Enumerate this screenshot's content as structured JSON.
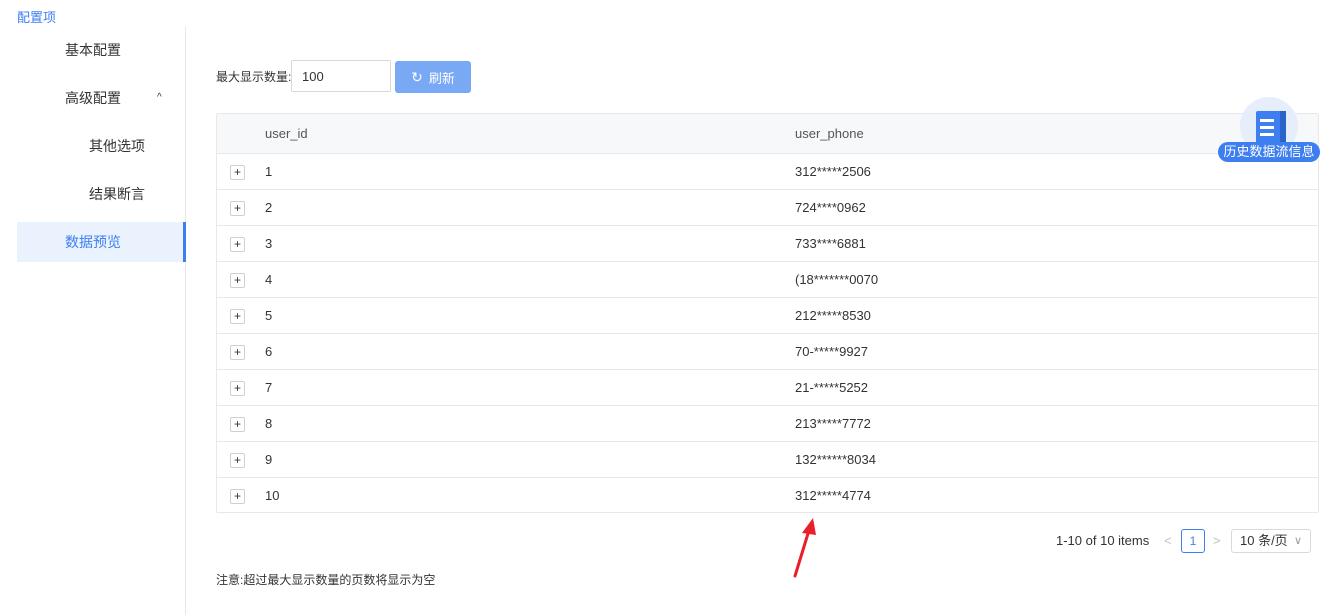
{
  "page_title": "配置项",
  "sidebar": {
    "items": [
      {
        "label": "基本配置"
      },
      {
        "label": "高级配置",
        "icon": "chevron-up-icon",
        "glyph": "^"
      },
      {
        "label": "其他选项"
      },
      {
        "label": "结果断言"
      },
      {
        "label": "数据预览"
      }
    ]
  },
  "toolbar": {
    "max_label": "最大显示数量:",
    "max_value": "100",
    "refresh_label": "刷新",
    "refresh_icon": "refresh-icon",
    "refresh_glyph": "↻"
  },
  "table": {
    "columns": [
      "user_id",
      "user_phone"
    ],
    "expand_glyph": "+",
    "rows": [
      {
        "user_id": "1",
        "user_phone": "312*****2506"
      },
      {
        "user_id": "2",
        "user_phone": "724****0962"
      },
      {
        "user_id": "3",
        "user_phone": "733****6881"
      },
      {
        "user_id": "4",
        "user_phone": "(18*******0070"
      },
      {
        "user_id": "5",
        "user_phone": "212*****8530"
      },
      {
        "user_id": "6",
        "user_phone": "70-*****9927"
      },
      {
        "user_id": "7",
        "user_phone": "21-*****5252"
      },
      {
        "user_id": "8",
        "user_phone": "213*****7772"
      },
      {
        "user_id": "9",
        "user_phone": "132******8034"
      },
      {
        "user_id": "10",
        "user_phone": "312*****4774"
      }
    ]
  },
  "pagination": {
    "info": "1-10 of 10 items",
    "prev_glyph": "<",
    "next_glyph": ">",
    "current_page": "1",
    "page_size": "10 条/页",
    "size_chevron": "∨"
  },
  "note": "注意:超过最大显示数量的页数将显示为空",
  "float_widget": {
    "label": "历史数据流信息",
    "icon": "history-data-icon"
  },
  "colors": {
    "accent": "#3d7ff0",
    "button": "#79a8f5",
    "active_bg": "#eaf2fd",
    "annotation_arrow": "#e8202a"
  }
}
